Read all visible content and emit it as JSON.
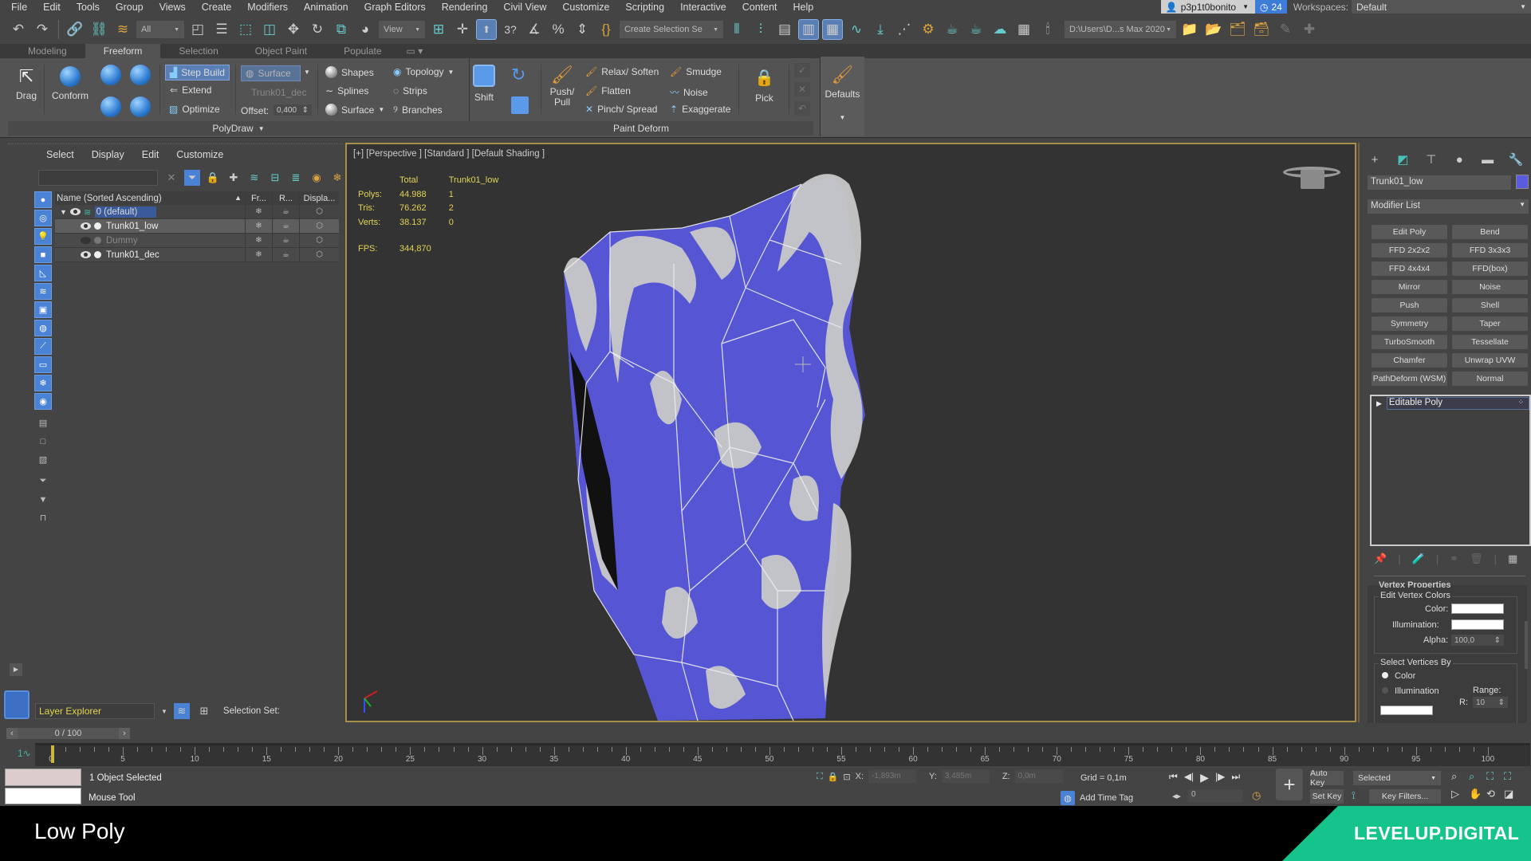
{
  "menubar": {
    "items": [
      "File",
      "Edit",
      "Tools",
      "Group",
      "Views",
      "Create",
      "Modifiers",
      "Animation",
      "Graph Editors",
      "Rendering",
      "Civil View",
      "Customize",
      "Scripting",
      "Interactive",
      "Content",
      "Help"
    ],
    "user": "p3p1t0bonito",
    "notifications": "24",
    "workspaces_label": "Workspaces:",
    "workspace": "Default"
  },
  "toolbar": {
    "selection_filter": "All",
    "reference_coord": "View",
    "named_selection": "Create Selection Se",
    "project_path": "D:\\Users\\D...s Max 2020"
  },
  "ribbon": {
    "tabs": [
      "Modeling",
      "Freeform",
      "Selection",
      "Object Paint",
      "Populate"
    ],
    "active_tab": "Freeform",
    "polydraw": {
      "drag": "Drag",
      "conform": "Conform",
      "step_build": "Step Build",
      "extend": "Extend",
      "optimize": "Optimize",
      "surface_btn": "Surface",
      "draw_on_object": "Trunk01_dec",
      "offset_label": "Offset:",
      "offset_value": "0,400",
      "shapes": "Shapes",
      "splines": "Splines",
      "surface": "Surface",
      "topology": "Topology",
      "strips": "Strips",
      "branches": "Branches",
      "panel_label": "PolyDraw"
    },
    "paint_deform": {
      "shift": "Shift",
      "push_pull": "Push/ Pull",
      "relax_soften": "Relax/ Soften",
      "flatten": "Flatten",
      "pinch_spread": "Pinch/ Spread",
      "smudge": "Smudge",
      "noise": "Noise",
      "exaggerate": "Exaggerate",
      "pick": "Pick",
      "panel_label": "Paint Deform"
    },
    "defaults": "Defaults"
  },
  "scene_explorer": {
    "menu": [
      "Select",
      "Display",
      "Edit",
      "Customize"
    ],
    "search_value": "",
    "columns": [
      "Name (Sorted Ascending)",
      "Fr...",
      "R...",
      "Displa..."
    ],
    "rows": [
      {
        "name": "0 (default)",
        "type": "layer",
        "selected": true
      },
      {
        "name": "Trunk01_low",
        "type": "object",
        "selected": true
      },
      {
        "name": "Dummy",
        "type": "object",
        "hidden": true
      },
      {
        "name": "Trunk01_dec",
        "type": "object"
      }
    ],
    "explorer_type": "Layer Explorer",
    "selection_set_label": "Selection Set:"
  },
  "viewport": {
    "label": "[+] [Perspective ] [Standard ] [Default Shading ]",
    "stats": {
      "header": [
        "",
        "Total",
        "Trunk01_low"
      ],
      "rows": [
        {
          "label": "Polys:",
          "total": "44.988",
          "selected": "1"
        },
        {
          "label": "Tris:",
          "total": "76.262",
          "selected": "2"
        },
        {
          "label": "Verts:",
          "total": "38.137",
          "selected": "0"
        }
      ],
      "fps_label": "FPS:",
      "fps": "344,870"
    },
    "mesh_color": "#5b5be0"
  },
  "command_panel": {
    "object_name": "Trunk01_low",
    "object_color": "#5b5be0",
    "modifier_list": "Modifier List",
    "modifier_buttons": [
      "Edit Poly",
      "Bend",
      "FFD 2x2x2",
      "FFD 3x3x3",
      "FFD 4x4x4",
      "FFD(box)",
      "Mirror",
      "Noise",
      "Push",
      "Shell",
      "Symmetry",
      "Taper",
      "TurboSmooth",
      "Tessellate",
      "Chamfer",
      "Unwrap UVW",
      "PathDeform (WSM)",
      "Normal"
    ],
    "stack_item": "Editable Poly",
    "rollout_title": "Vertex Properties",
    "edit_vertex_colors": "Edit Vertex Colors",
    "color_label": "Color:",
    "illumination_label": "Illumination:",
    "alpha_label": "Alpha:",
    "alpha_value": "100,0",
    "select_vertices_by": "Select Vertices By",
    "radio_color": "Color",
    "radio_illumination": "Illumination",
    "range_label": "Range:",
    "r_label": "R:",
    "r_value": "10"
  },
  "timeline": {
    "slider": "0 / 100",
    "ticks": [
      0,
      5,
      10,
      15,
      20,
      25,
      30,
      35,
      40,
      45,
      50,
      55,
      60,
      65,
      70,
      75,
      80,
      85,
      90,
      95,
      100
    ],
    "current_frame": 0
  },
  "status": {
    "selection": "1 Object Selected",
    "prompt": "Mouse Tool",
    "x_label": "X:",
    "x": "-1,893m",
    "y_label": "Y:",
    "y": "3,485m",
    "z_label": "Z:",
    "z": "0,0m",
    "grid": "Grid = 0,1m",
    "add_time_tag": "Add Time Tag",
    "frame": "0",
    "auto_key": "Auto Key",
    "set_key": "Set Key",
    "key_mode": "Selected",
    "key_filters": "Key Filters..."
  },
  "caption": {
    "title": "Low Poly",
    "brand": "LEVELUP.DIGITAL",
    "brand_color": "#15c48c"
  }
}
